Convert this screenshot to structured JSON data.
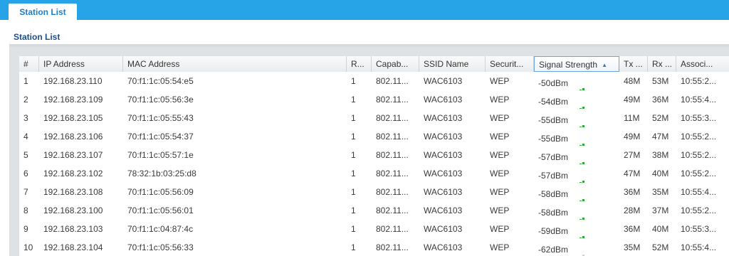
{
  "tab": {
    "label": "Station List"
  },
  "section": {
    "title": "Station List"
  },
  "table": {
    "columns": [
      {
        "key": "num",
        "label": "#"
      },
      {
        "key": "ip",
        "label": "IP Address"
      },
      {
        "key": "mac",
        "label": "MAC Address"
      },
      {
        "key": "radio",
        "label": "R..."
      },
      {
        "key": "cap",
        "label": "Capab..."
      },
      {
        "key": "ssid",
        "label": "SSID Name"
      },
      {
        "key": "sec",
        "label": "Securit..."
      },
      {
        "key": "signal",
        "label": "Signal Strength"
      },
      {
        "key": "tx",
        "label": "Tx ..."
      },
      {
        "key": "rx",
        "label": "Rx ..."
      },
      {
        "key": "assoc",
        "label": "Associ..."
      }
    ],
    "sort": {
      "column": "Signal Strength",
      "direction": "ascending"
    },
    "colors": {
      "bar_on": "#36a33f",
      "bar_off": "#cfd3d6",
      "header_bg": "#eef1f3",
      "accent": "#27a4e8"
    },
    "rows": [
      {
        "num": "1",
        "ip": "192.168.23.110",
        "mac": "70:f1:1c:05:54:e5",
        "radio": "1",
        "cap": "802.11...",
        "ssid": "WAC6103",
        "sec": "WEP",
        "signal": "-50dBm",
        "bars": 5,
        "tx": "48M",
        "rx": "53M",
        "assoc": "10:55:2..."
      },
      {
        "num": "2",
        "ip": "192.168.23.109",
        "mac": "70:f1:1c:05:56:3e",
        "radio": "1",
        "cap": "802.11...",
        "ssid": "WAC6103",
        "sec": "WEP",
        "signal": "-54dBm",
        "bars": 5,
        "tx": "49M",
        "rx": "36M",
        "assoc": "10:55:4..."
      },
      {
        "num": "3",
        "ip": "192.168.23.105",
        "mac": "70:f1:1c:05:55:43",
        "radio": "1",
        "cap": "802.11...",
        "ssid": "WAC6103",
        "sec": "WEP",
        "signal": "-55dBm",
        "bars": 5,
        "tx": "11M",
        "rx": "52M",
        "assoc": "10:55:3..."
      },
      {
        "num": "4",
        "ip": "192.168.23.106",
        "mac": "70:f1:1c:05:54:37",
        "radio": "1",
        "cap": "802.11...",
        "ssid": "WAC6103",
        "sec": "WEP",
        "signal": "-55dBm",
        "bars": 5,
        "tx": "49M",
        "rx": "47M",
        "assoc": "10:55:2..."
      },
      {
        "num": "5",
        "ip": "192.168.23.107",
        "mac": "70:f1:1c:05:57:1e",
        "radio": "1",
        "cap": "802.11...",
        "ssid": "WAC6103",
        "sec": "WEP",
        "signal": "-57dBm",
        "bars": 5,
        "tx": "27M",
        "rx": "38M",
        "assoc": "10:55:2..."
      },
      {
        "num": "6",
        "ip": "192.168.23.102",
        "mac": "78:32:1b:03:25:d8",
        "radio": "1",
        "cap": "802.11...",
        "ssid": "WAC6103",
        "sec": "WEP",
        "signal": "-57dBm",
        "bars": 5,
        "tx": "47M",
        "rx": "40M",
        "assoc": "10:55:2..."
      },
      {
        "num": "7",
        "ip": "192.168.23.108",
        "mac": "70:f1:1c:05:56:09",
        "radio": "1",
        "cap": "802.11...",
        "ssid": "WAC6103",
        "sec": "WEP",
        "signal": "-58dBm",
        "bars": 5,
        "tx": "36M",
        "rx": "35M",
        "assoc": "10:55:4..."
      },
      {
        "num": "8",
        "ip": "192.168.23.100",
        "mac": "70:f1:1c:05:56:01",
        "radio": "1",
        "cap": "802.11...",
        "ssid": "WAC6103",
        "sec": "WEP",
        "signal": "-58dBm",
        "bars": 5,
        "tx": "28M",
        "rx": "37M",
        "assoc": "10:55:2..."
      },
      {
        "num": "9",
        "ip": "192.168.23.103",
        "mac": "70:f1:1c:04:87:4c",
        "radio": "1",
        "cap": "802.11...",
        "ssid": "WAC6103",
        "sec": "WEP",
        "signal": "-59dBm",
        "bars": 5,
        "tx": "36M",
        "rx": "40M",
        "assoc": "10:55:3..."
      },
      {
        "num": "10",
        "ip": "192.168.23.104",
        "mac": "70:f1:1c:05:56:33",
        "radio": "1",
        "cap": "802.11...",
        "ssid": "WAC6103",
        "sec": "WEP",
        "signal": "-62dBm",
        "bars": 4,
        "tx": "35M",
        "rx": "52M",
        "assoc": "10:55:4..."
      }
    ]
  }
}
